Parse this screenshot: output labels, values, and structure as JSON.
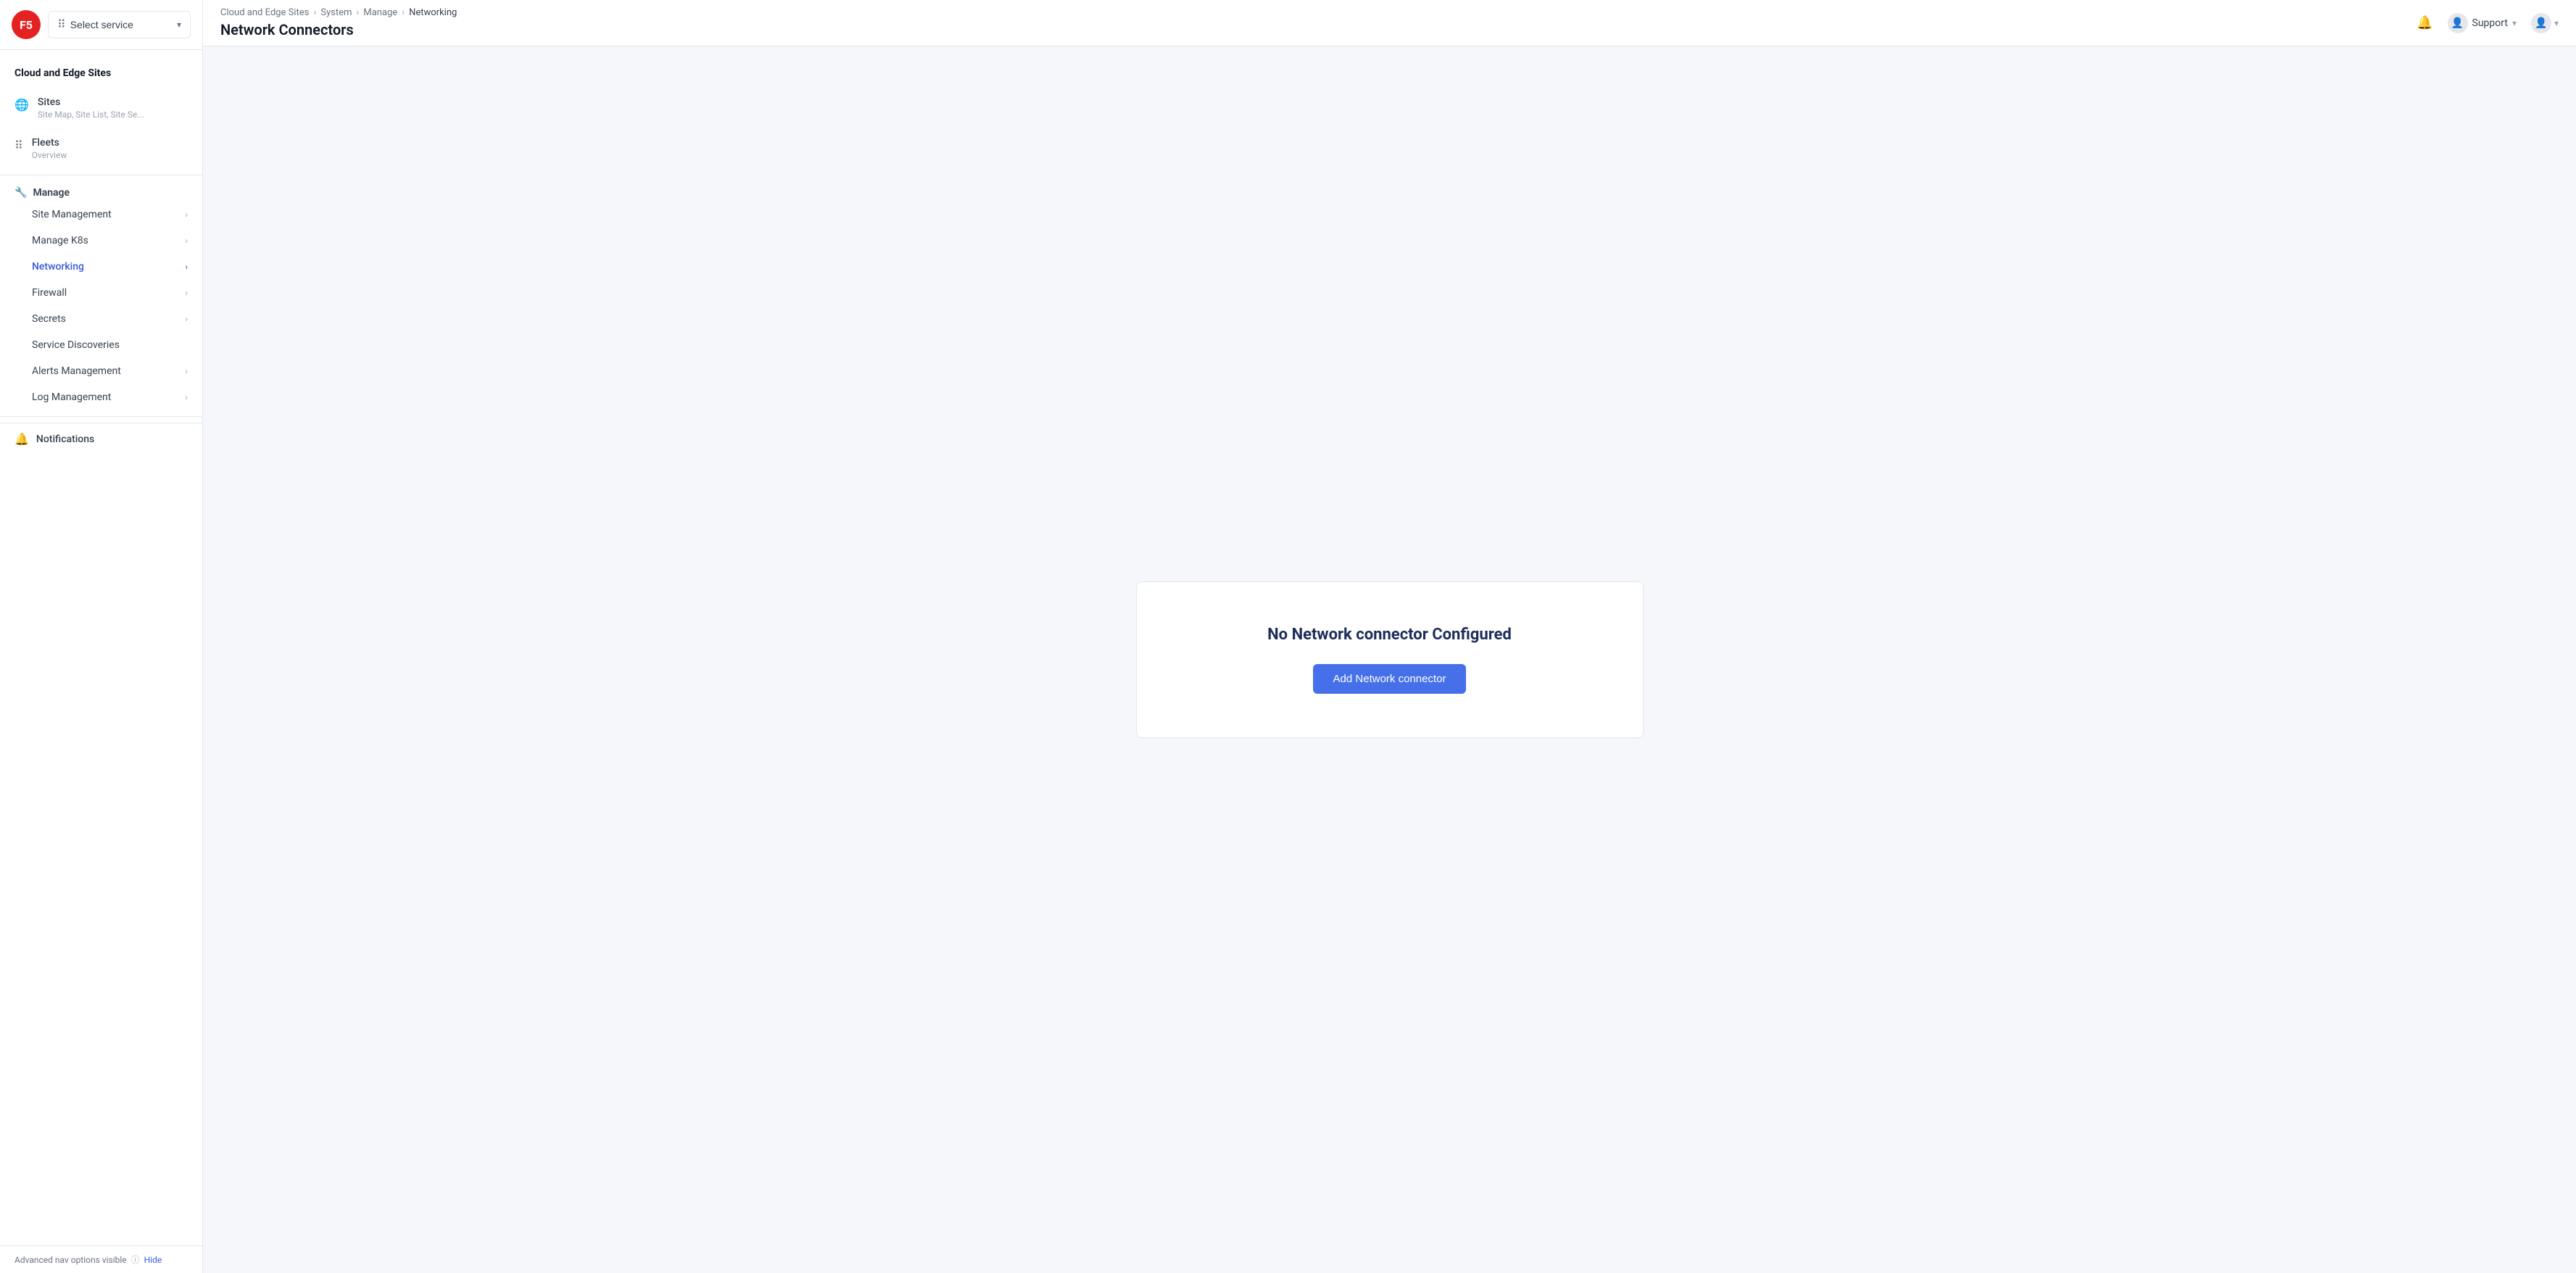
{
  "logo": {
    "text": "F5"
  },
  "sidebar": {
    "select_service_label": "Select service",
    "section_title": "Cloud and Edge Sites",
    "sites_label": "Sites",
    "sites_sub": "Site Map, Site List, Site Se...",
    "fleets_label": "Fleets",
    "fleets_sub": "Overview",
    "manage_label": "Manage",
    "menu_items": [
      {
        "label": "Site Management",
        "has_arrow": true,
        "active": false
      },
      {
        "label": "Manage K8s",
        "has_arrow": true,
        "active": false
      },
      {
        "label": "Networking",
        "has_arrow": true,
        "active": true
      },
      {
        "label": "Firewall",
        "has_arrow": true,
        "active": false
      },
      {
        "label": "Secrets",
        "has_arrow": true,
        "active": false
      },
      {
        "label": "Service Discoveries",
        "has_arrow": false,
        "active": false
      },
      {
        "label": "Alerts Management",
        "has_arrow": true,
        "active": false
      },
      {
        "label": "Log Management",
        "has_arrow": true,
        "active": false
      }
    ],
    "notifications_label": "Notifications",
    "footer_text": "Advanced nav options visible",
    "hide_label": "Hide"
  },
  "topbar": {
    "breadcrumbs": [
      "Cloud and Edge Sites",
      "System",
      "Manage",
      "Networking"
    ],
    "page_title": "Network Connectors",
    "support_label": "Support"
  },
  "main": {
    "empty_state_title": "No Network connector Configured",
    "add_button_label": "Add Network connector"
  }
}
